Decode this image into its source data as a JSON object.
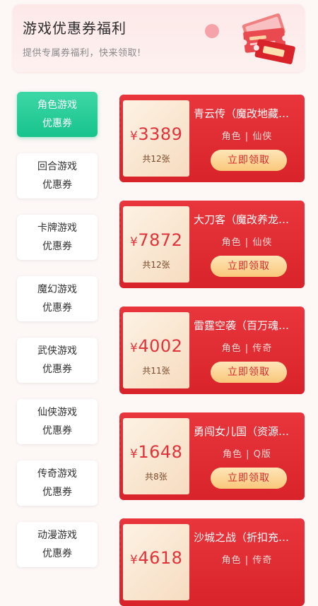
{
  "banner": {
    "title": "游戏优惠券福利",
    "subtitle": "提供专属券福利，快来领取!"
  },
  "sidebar": {
    "items": [
      {
        "line1": "角色游戏",
        "line2": "优惠券",
        "active": true
      },
      {
        "line1": "回合游戏",
        "line2": "优惠券"
      },
      {
        "line1": "卡牌游戏",
        "line2": "优惠券"
      },
      {
        "line1": "魔幻游戏",
        "line2": "优惠券"
      },
      {
        "line1": "武侠游戏",
        "line2": "优惠券"
      },
      {
        "line1": "仙侠游戏",
        "line2": "优惠券"
      },
      {
        "line1": "传奇游戏",
        "line2": "优惠券"
      },
      {
        "line1": "动漫游戏",
        "line2": "优惠券"
      }
    ]
  },
  "coupons": [
    {
      "currency": "¥",
      "amount": "3389",
      "count": "共12张",
      "name": "青云传（魔改地藏…",
      "tags": "角色 | 仙侠",
      "button": "立即领取"
    },
    {
      "currency": "¥",
      "amount": "7872",
      "count": "共12张",
      "name": "大刀客（魔改养龙…",
      "tags": "角色 | 仙侠",
      "button": "立即领取"
    },
    {
      "currency": "¥",
      "amount": "4002",
      "count": "共11张",
      "name": "雷霆空袭（百万魂…",
      "tags": "角色 | 传奇",
      "button": "立即领取"
    },
    {
      "currency": "¥",
      "amount": "1648",
      "count": "共8张",
      "name": "勇闯女儿国（资源…",
      "tags": "角色 | Q版",
      "button": "立即领取"
    },
    {
      "currency": "¥",
      "amount": "4618",
      "count": "",
      "name": "沙城之战（折扣充…",
      "tags": "角色 | 传奇",
      "button": ""
    }
  ],
  "colors": {
    "accent_green": "#18c38c",
    "coupon_red": "#d9232b",
    "button_gold": "#f9c87b"
  }
}
